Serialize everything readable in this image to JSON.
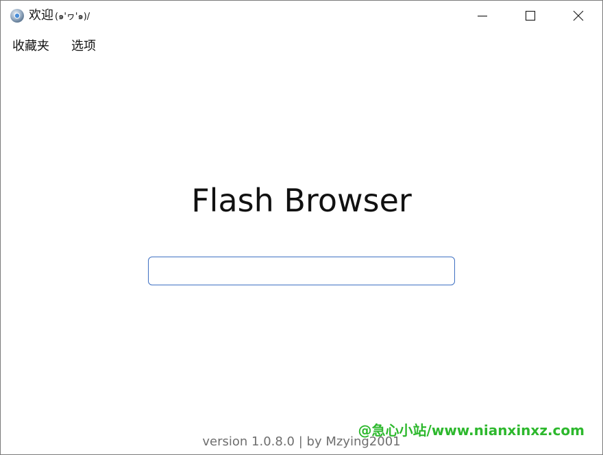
{
  "window": {
    "title": "欢迎",
    "title_kaomoji": "(๑'ヮ'๑)/",
    "app_icon": "browser-globe-icon",
    "controls": {
      "minimize_icon": "minimize-icon",
      "maximize_icon": "maximize-icon",
      "close_icon": "close-icon"
    }
  },
  "menu": {
    "items": [
      {
        "label": "收藏夹"
      },
      {
        "label": "选项"
      }
    ]
  },
  "main": {
    "heading": "Flash Browser",
    "address_input": {
      "value": "",
      "placeholder": ""
    },
    "input_border_color": "#3d6fc2"
  },
  "footer": {
    "version": "version 1.0.8.0 | by Mzying2001"
  },
  "watermark": {
    "text": "@急心小站/www.nianxinxz.com",
    "color": "#2db82d"
  }
}
